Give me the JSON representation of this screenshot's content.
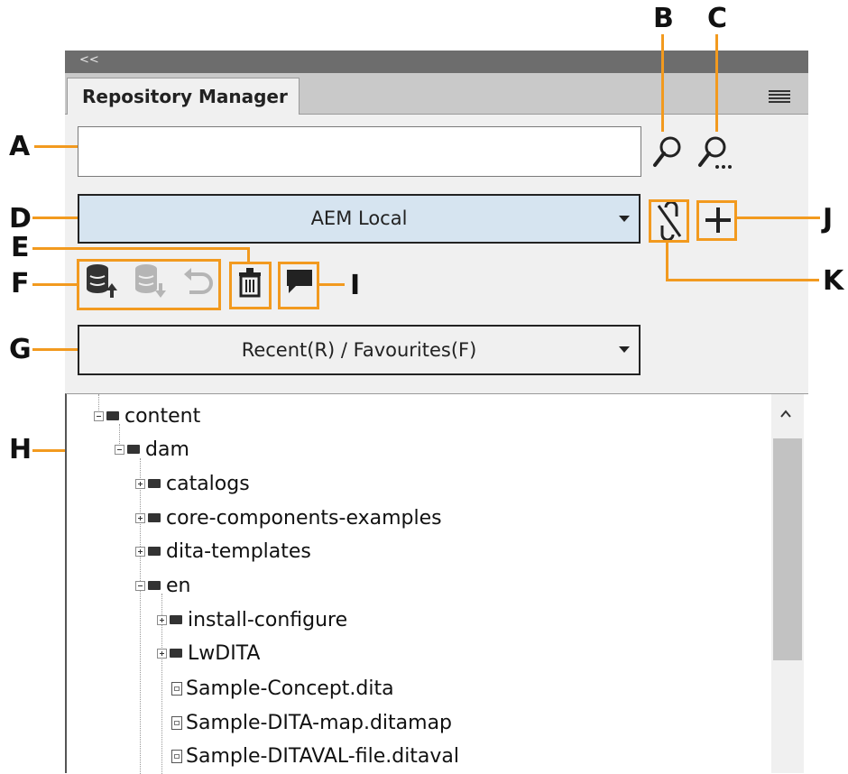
{
  "panel": {
    "collapse_glyph": "<<",
    "tab_title": "Repository Manager",
    "menu_icon": "hamburger-menu-icon"
  },
  "search": {
    "value": "",
    "placeholder": ""
  },
  "repository": {
    "selected": "AEM Local"
  },
  "filter": {
    "selected": "Recent(R) / Favourites(F)"
  },
  "toolbar_icons": [
    "checkout-database-icon",
    "checkin-database-icon",
    "undo-icon",
    "trash-icon",
    "comment-icon",
    "unlink-icon",
    "add-icon",
    "search-icon",
    "advanced-search-icon"
  ],
  "callouts": {
    "A": "A",
    "B": "B",
    "C": "C",
    "D": "D",
    "E": "E",
    "F": "F",
    "G": "G",
    "H": "H",
    "I": "I",
    "J": "J",
    "K": "K"
  },
  "tree": [
    {
      "label": "content",
      "type": "folder",
      "state": "expanded"
    },
    {
      "label": "dam",
      "type": "folder",
      "state": "expanded"
    },
    {
      "label": "catalogs",
      "type": "folder",
      "state": "collapsed"
    },
    {
      "label": "core-components-examples",
      "type": "folder",
      "state": "collapsed"
    },
    {
      "label": "dita-templates",
      "type": "folder",
      "state": "collapsed"
    },
    {
      "label": "en",
      "type": "folder",
      "state": "expanded"
    },
    {
      "label": "install-configure",
      "type": "folder",
      "state": "collapsed"
    },
    {
      "label": "LwDITA",
      "type": "folder",
      "state": "collapsed"
    },
    {
      "label": "Sample-Concept.dita",
      "type": "file"
    },
    {
      "label": "Sample-DITA-map.ditamap",
      "type": "file"
    },
    {
      "label": "Sample-DITAVAL-file.ditaval",
      "type": "file"
    }
  ],
  "colors": {
    "accent_orange": "#f29a1f",
    "select_blue": "#d6e4f0"
  }
}
